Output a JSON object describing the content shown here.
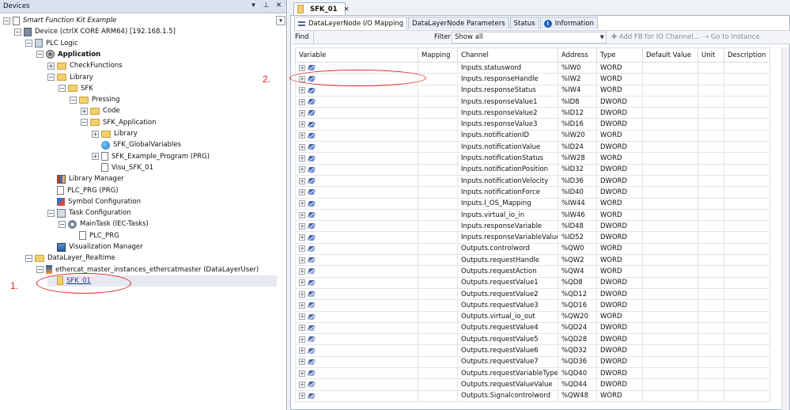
{
  "devices_panel": {
    "title": "Devices",
    "tree": [
      {
        "label": "Smart Function Kit Example",
        "style": "italic",
        "icon": "project-icon",
        "level": 0,
        "expander": "-"
      },
      {
        "label": "Device (ctrlX CORE ARM64) [192.168.1.5]",
        "icon": "device-icon",
        "level": 1,
        "expander": "-"
      },
      {
        "label": "PLC Logic",
        "icon": "plc-logic-icon",
        "level": 2,
        "expander": "-"
      },
      {
        "label": "Application",
        "style": "bold",
        "icon": "application-icon",
        "level": 3,
        "expander": "-"
      },
      {
        "label": "CheckFunctions",
        "icon": "folder-icon",
        "level": 4,
        "expander": "+"
      },
      {
        "label": "Library",
        "icon": "folder-icon",
        "level": 4,
        "expander": "-"
      },
      {
        "label": "SFK",
        "icon": "folder-icon",
        "level": 5,
        "expander": "-"
      },
      {
        "label": "Pressing",
        "icon": "folder-icon",
        "level": 6,
        "expander": "-"
      },
      {
        "label": "Code",
        "icon": "folder-icon",
        "level": 7,
        "expander": "+"
      },
      {
        "label": "SFK_Application",
        "icon": "folder-icon",
        "level": 7,
        "expander": "-"
      },
      {
        "label": "Library",
        "icon": "folder-icon",
        "level": 8,
        "expander": "+"
      },
      {
        "label": "SFK_GlobalVariables",
        "icon": "global-variables-icon",
        "level": 8,
        "expander": ""
      },
      {
        "label": "SFK_Example_Program (PRG)",
        "icon": "program-icon",
        "level": 8,
        "expander": "+"
      },
      {
        "label": "Visu_SFK_01",
        "icon": "visu-icon",
        "level": 8,
        "expander": ""
      },
      {
        "label": "Library Manager",
        "icon": "library-manager-icon",
        "level": 4,
        "expander": ""
      },
      {
        "label": "PLC_PRG (PRG)",
        "icon": "program-icon",
        "level": 4,
        "expander": ""
      },
      {
        "label": "Symbol Configuration",
        "icon": "symbol-config-icon",
        "level": 4,
        "expander": ""
      },
      {
        "label": "Task Configuration",
        "icon": "task-config-icon",
        "level": 4,
        "expander": "-"
      },
      {
        "label": "MainTask (IEC-Tasks)",
        "icon": "gear-icon",
        "level": 5,
        "expander": "-"
      },
      {
        "label": "PLC_PRG",
        "icon": "program-call-icon",
        "level": 6,
        "expander": ""
      },
      {
        "label": "Visualization Manager",
        "icon": "visualization-manager-icon",
        "level": 4,
        "expander": ""
      },
      {
        "label": "DataLayer_Realtime",
        "icon": "datalayer-icon",
        "level": 2,
        "expander": "-"
      },
      {
        "label": "ethercat_master_instances_ethercatmaster (DataLayerUser)",
        "icon": "ethercat-icon",
        "level": 3,
        "expander": "-"
      },
      {
        "label": "SFK_01",
        "style": "link",
        "icon": "sfk-node-icon",
        "level": 4,
        "expander": "",
        "selected": true
      }
    ]
  },
  "annotations": {
    "marker_1": "1.",
    "marker_2": "2."
  },
  "editor": {
    "document_tab": "SFK_01",
    "document_tab_close": "×",
    "tabs": [
      {
        "label": "DataLayerNode I/O Mapping",
        "active": true,
        "icon": "mapping-icon"
      },
      {
        "label": "DataLayerNode Parameters"
      },
      {
        "label": "Status"
      },
      {
        "label": "Information",
        "icon": "info-icon"
      }
    ],
    "toolbar": {
      "find_label": "Find",
      "filter_label": "Filter",
      "filter_value": "Show all",
      "add_fb_label": "Add FB for IO Channel...",
      "goto_label": "Go to Instance"
    },
    "columns": [
      "Variable",
      "Mapping",
      "Channel",
      "Address",
      "Type",
      "Default Value",
      "Unit",
      "Description"
    ],
    "rows": [
      {
        "channel": "Inputs.statusword",
        "address": "%IW0",
        "type": "WORD",
        "dir": "in"
      },
      {
        "channel": "Inputs.responseHandle",
        "address": "%IW2",
        "type": "WORD",
        "dir": "in"
      },
      {
        "channel": "Inputs.responseStatus",
        "address": "%IW4",
        "type": "WORD",
        "dir": "in"
      },
      {
        "channel": "Inputs.responseValue1",
        "address": "%ID8",
        "type": "DWORD",
        "dir": "in"
      },
      {
        "channel": "Inputs.responseValue2",
        "address": "%ID12",
        "type": "DWORD",
        "dir": "in"
      },
      {
        "channel": "Inputs.responseValue3",
        "address": "%ID16",
        "type": "DWORD",
        "dir": "in"
      },
      {
        "channel": "Inputs.notificationID",
        "address": "%IW20",
        "type": "WORD",
        "dir": "in"
      },
      {
        "channel": "Inputs.notificationValue",
        "address": "%ID24",
        "type": "DWORD",
        "dir": "in"
      },
      {
        "channel": "Inputs.notificationStatus",
        "address": "%IW28",
        "type": "WORD",
        "dir": "in"
      },
      {
        "channel": "Inputs.notificationPosition",
        "address": "%ID32",
        "type": "DWORD",
        "dir": "in"
      },
      {
        "channel": "Inputs.notificationVelocity",
        "address": "%ID36",
        "type": "DWORD",
        "dir": "in"
      },
      {
        "channel": "Inputs.notificationForce",
        "address": "%ID40",
        "type": "DWORD",
        "dir": "in"
      },
      {
        "channel": "Inputs.I_OS_Mapping",
        "address": "%IW44",
        "type": "WORD",
        "dir": "in"
      },
      {
        "channel": "Inputs.virtual_io_in",
        "address": "%IW46",
        "type": "WORD",
        "dir": "in"
      },
      {
        "channel": "Inputs.responseVariable",
        "address": "%ID48",
        "type": "DWORD",
        "dir": "in"
      },
      {
        "channel": "Inputs.responseVariableValue",
        "address": "%ID52",
        "type": "DWORD",
        "dir": "in"
      },
      {
        "channel": "Outputs.controlword",
        "address": "%QW0",
        "type": "WORD",
        "dir": "out"
      },
      {
        "channel": "Outputs.requestHandle",
        "address": "%QW2",
        "type": "WORD",
        "dir": "out"
      },
      {
        "channel": "Outputs.requestAction",
        "address": "%QW4",
        "type": "WORD",
        "dir": "out"
      },
      {
        "channel": "Outputs.requestValue1",
        "address": "%QD8",
        "type": "DWORD",
        "dir": "out"
      },
      {
        "channel": "Outputs.requestValue2",
        "address": "%QD12",
        "type": "DWORD",
        "dir": "out"
      },
      {
        "channel": "Outputs.requestValue3",
        "address": "%QD16",
        "type": "DWORD",
        "dir": "out"
      },
      {
        "channel": "Outputs.virtual_io_out",
        "address": "%QW20",
        "type": "WORD",
        "dir": "out"
      },
      {
        "channel": "Outputs.requestValue4",
        "address": "%QD24",
        "type": "DWORD",
        "dir": "out"
      },
      {
        "channel": "Outputs.requestValue5",
        "address": "%QD28",
        "type": "DWORD",
        "dir": "out"
      },
      {
        "channel": "Outputs.requestValue6",
        "address": "%QD32",
        "type": "DWORD",
        "dir": "out"
      },
      {
        "channel": "Outputs.requestValue7",
        "address": "%QD36",
        "type": "DWORD",
        "dir": "out"
      },
      {
        "channel": "Outputs.requestVariableType",
        "address": "%QD40",
        "type": "DWORD",
        "dir": "out"
      },
      {
        "channel": "Outputs.requestValueValue",
        "address": "%QD44",
        "type": "DWORD",
        "dir": "out"
      },
      {
        "channel": "Outputs.Signalcontrolword",
        "address": "%QW48",
        "type": "WORD",
        "dir": "out"
      }
    ]
  },
  "colors": {
    "annotation": "#e02020",
    "panel_title": "#d9e2ee",
    "link": "#1d3d8c"
  }
}
